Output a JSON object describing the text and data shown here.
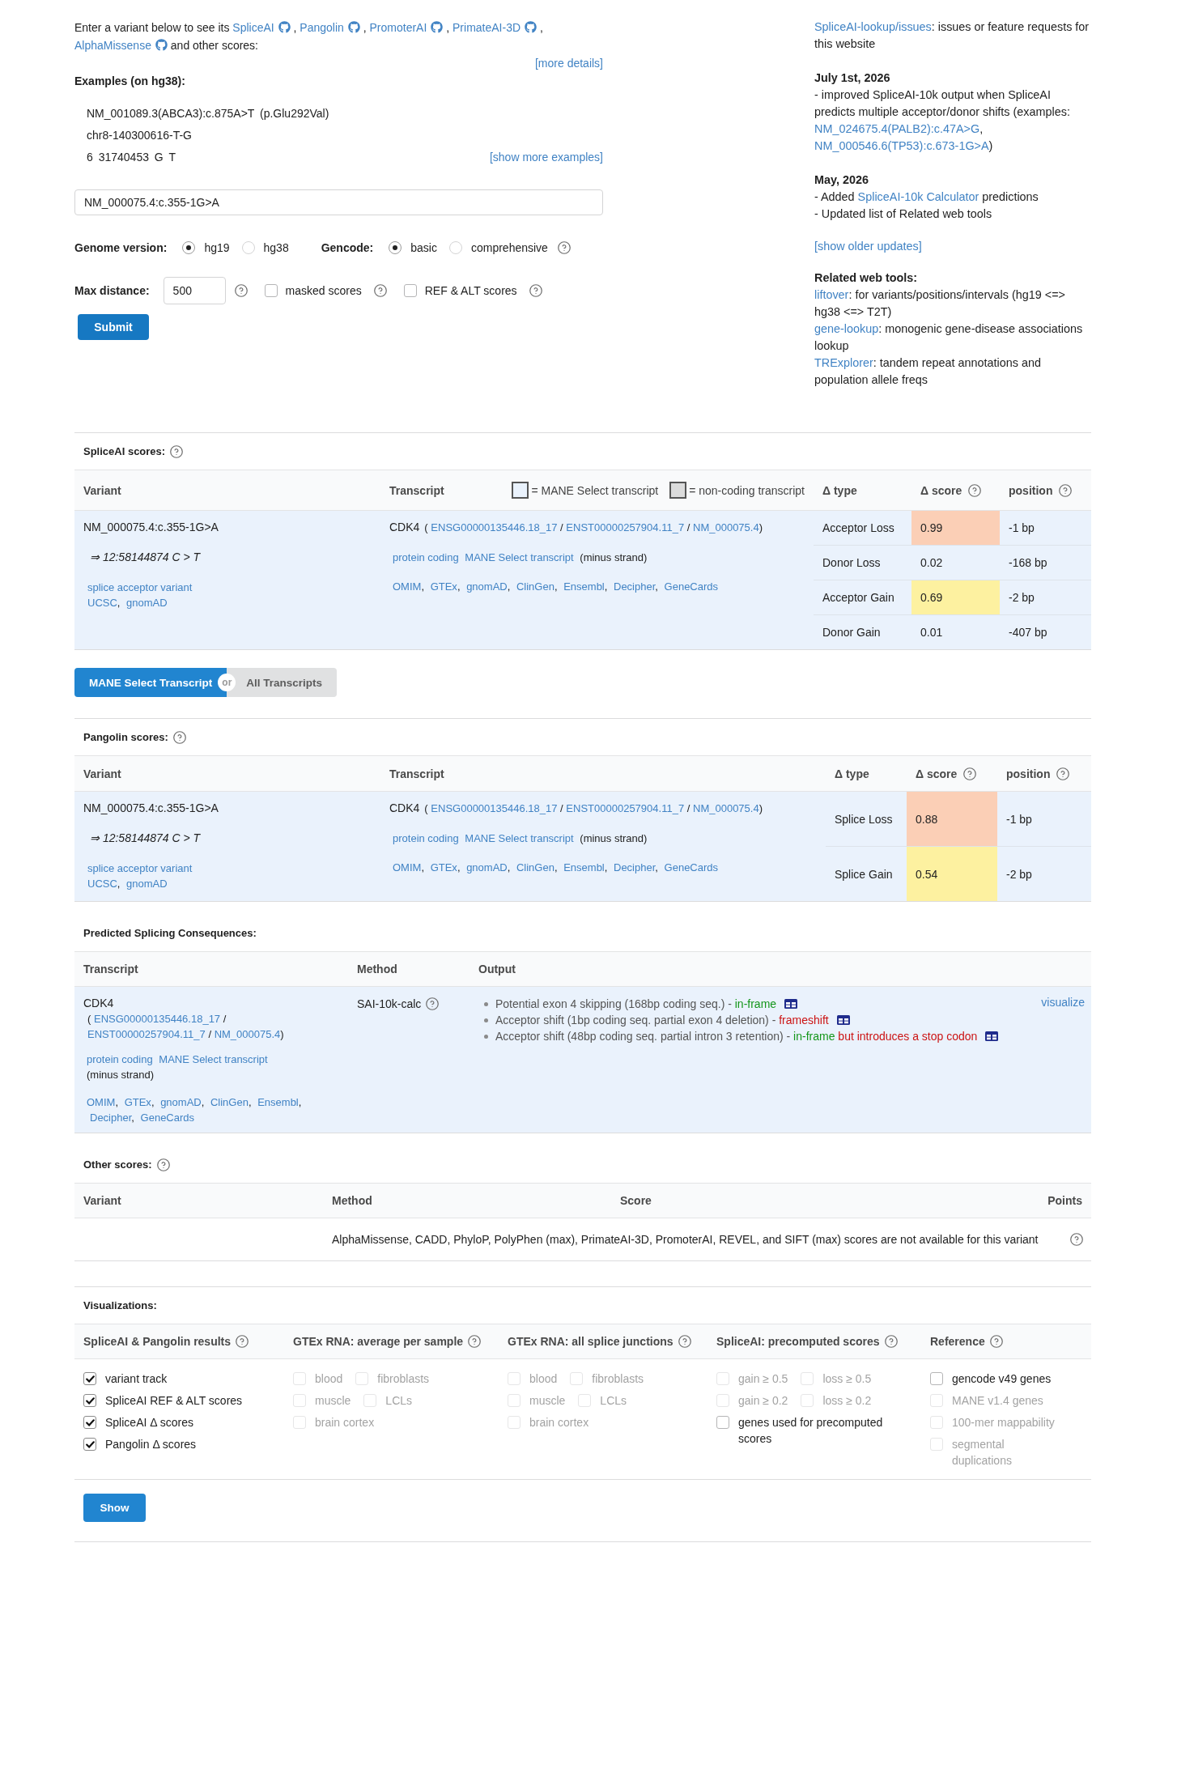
{
  "intro": {
    "lead": "Enter a variant below to see its",
    "tools": [
      {
        "label": "SpliceAI",
        "after": ","
      },
      {
        "label": "Pangolin",
        "after": ","
      },
      {
        "label": "PromoterAI",
        "after": ","
      },
      {
        "label": "PrimateAI-3D",
        "after": ","
      },
      {
        "label": "AlphaMissense"
      }
    ],
    "tail": "and other scores:",
    "more_details": "[more details]"
  },
  "examples": {
    "title": "Examples (on hg38):",
    "items": [
      "NM_001089.3(ABCA3):c.875A>T (p.Glu292Val)",
      "chr8-140300616-T-G",
      "6 31740453 G T"
    ],
    "more": "[show more examples]"
  },
  "variant_input": {
    "value": "NM_000075.4:c.355-1G>A"
  },
  "genome_version": {
    "label": "Genome version:",
    "options": [
      {
        "label": "hg19",
        "selected": true
      },
      {
        "label": "hg38",
        "selected": false
      }
    ]
  },
  "gencode": {
    "label": "Gencode:",
    "options": [
      {
        "label": "basic",
        "selected": true
      },
      {
        "label": "comprehensive",
        "selected": false
      }
    ]
  },
  "max_distance": {
    "label": "Max distance:",
    "value": "500"
  },
  "score_options": [
    {
      "label": "masked scores",
      "checked": false
    },
    {
      "label": "REF & ALT scores",
      "checked": false
    }
  ],
  "submit": "Submit",
  "sidebar": {
    "issues": {
      "link": "SpliceAI-lookup/issues",
      "text": ": issues or feature requests for this website"
    },
    "updates": [
      {
        "date": "July 1st, 2026",
        "lines": [
          {
            "parts": [
              {
                "kind": "text",
                "text": "- improved SpliceAI-10k output when SpliceAI predicts multiple acceptor/donor shifts (examples: "
              },
              {
                "kind": "link",
                "text": "NM_024675.4(PALB2):c.47A>G"
              },
              {
                "kind": "text",
                "text": ", "
              },
              {
                "kind": "link",
                "text": "NM_000546.6(TP53):c.673-1G>A"
              },
              {
                "kind": "text",
                "text": ")"
              }
            ]
          }
        ]
      },
      {
        "date": "May, 2026",
        "lines": [
          {
            "parts": [
              {
                "kind": "text",
                "text": "- Added "
              },
              {
                "kind": "link",
                "text": "SpliceAI-10k Calculator"
              },
              {
                "kind": "text",
                "text": " predictions"
              }
            ]
          },
          {
            "parts": [
              {
                "kind": "text",
                "text": "- Updated list of Related web tools"
              }
            ]
          }
        ]
      }
    ],
    "older": "[show older updates]",
    "related": {
      "title": "Related web tools:",
      "items": [
        {
          "link": "liftover",
          "text": ": for variants/positions/intervals (hg19 <=> hg38 <=> T2T)"
        },
        {
          "link": "gene-lookup",
          "text": ": monogenic gene-disease associations lookup"
        },
        {
          "link": "TRExplorer",
          "text": ": tandem repeat annotations and population allele freqs"
        }
      ]
    }
  },
  "spliceai": {
    "title": "SpliceAI scores:",
    "help": true,
    "columns": [
      {
        "label": "Variant"
      },
      {
        "label": "Transcript"
      },
      {
        "label": "Δ type"
      },
      {
        "label": "Δ score",
        "help": true
      },
      {
        "label": "position",
        "help": true
      }
    ],
    "legend": [
      {
        "label": "= MANE Select transcript",
        "color": "#eaf2fc"
      },
      {
        "label": "= non-coding transcript",
        "color": "#dcdcdc"
      }
    ],
    "variant": {
      "name": "NM_000075.4:c.355-1G>A",
      "position": "⇒ 12:58144874 C > T",
      "consequence": "splice acceptor variant",
      "links": [
        "UCSC",
        "gnomAD"
      ],
      "link_separator": ","
    },
    "transcript": {
      "gene": "CDK4",
      "open": "(",
      "ids": [
        "ENSG00000135446.18_17",
        "ENST00000257904.11_7",
        "NM_000075.4"
      ],
      "id_separator": "/",
      "close": ")",
      "tags": [
        "protein coding",
        "MANE Select transcript"
      ],
      "strand": "(minus strand)",
      "links": [
        "OMIM",
        "GTEx",
        "gnomAD",
        "ClinGen",
        "Ensembl",
        "Decipher",
        "GeneCards"
      ],
      "link_separator": ",",
      "mane_select": true
    },
    "scores": [
      {
        "type": "Acceptor Loss",
        "score": "0.99",
        "position": "-1 bp",
        "color": "#fbcfb6"
      },
      {
        "type": "Donor Loss",
        "score": "0.02",
        "position": "-168 bp"
      },
      {
        "type": "Acceptor Gain",
        "score": "0.69",
        "position": "-2 bp",
        "color": "#fdf1a0"
      },
      {
        "type": "Donor Gain",
        "score": "0.01",
        "position": "-407 bp"
      }
    ]
  },
  "transcript_toggle": {
    "options": [
      {
        "label": "MANE Select Transcript",
        "selected": true
      },
      {
        "label": "All Transcripts",
        "selected": false
      }
    ],
    "separator": "or"
  },
  "pangolin": {
    "title": "Pangolin scores:",
    "help": true,
    "columns": [
      {
        "label": "Variant"
      },
      {
        "label": "Transcript"
      },
      {
        "label": "Δ type"
      },
      {
        "label": "Δ score",
        "help": true
      },
      {
        "label": "position",
        "help": true
      }
    ],
    "variant": {
      "name": "NM_000075.4:c.355-1G>A",
      "position": "⇒ 12:58144874 C > T",
      "consequence": "splice acceptor variant",
      "links": [
        "UCSC",
        "gnomAD"
      ],
      "link_separator": ","
    },
    "transcript": {
      "gene": "CDK4",
      "open": "(",
      "ids": [
        "ENSG00000135446.18_17",
        "ENST00000257904.11_7",
        "NM_000075.4"
      ],
      "id_separator": "/",
      "close": ")",
      "tags": [
        "protein coding",
        "MANE Select transcript"
      ],
      "strand": "(minus strand)",
      "links": [
        "OMIM",
        "GTEx",
        "gnomAD",
        "ClinGen",
        "Ensembl",
        "Decipher",
        "GeneCards"
      ],
      "link_separator": ",",
      "mane_select": true
    },
    "scores": [
      {
        "type": "Splice Loss",
        "score": "0.88",
        "position": "-1 bp",
        "color": "#fbcfb6"
      },
      {
        "type": "Splice Gain",
        "score": "0.54",
        "position": "-2 bp",
        "color": "#fdf1a0"
      }
    ]
  },
  "consequences": {
    "title": "Predicted Splicing Consequences:",
    "columns": [
      {
        "label": "Transcript"
      },
      {
        "label": "Method"
      },
      {
        "label": "Output"
      }
    ],
    "transcript": {
      "gene": "CDK4",
      "open": "(",
      "ids": [
        "ENSG00000135446.18_17",
        "ENST00000257904.11_7",
        "NM_000075.4"
      ],
      "id_separator": "/",
      "close": ")",
      "tags": [
        "protein coding",
        "MANE Select transcript"
      ],
      "strand": "(minus strand)",
      "links": [
        "OMIM",
        "GTEx",
        "gnomAD",
        "ClinGen",
        "Ensembl",
        "Decipher",
        "GeneCards"
      ],
      "link_separator": ",",
      "mane_select": true
    },
    "method": "SAI-10k-calc",
    "outputs": [
      {
        "parts": [
          {
            "kind": "text",
            "text": "Potential exon 4 skipping (168bp coding seq.) - "
          },
          {
            "kind": "ok",
            "text": "in-frame"
          }
        ]
      },
      {
        "parts": [
          {
            "kind": "text",
            "text": "Acceptor shift (1bp coding seq. partial exon 4 deletion) - "
          },
          {
            "kind": "bad",
            "text": "frameshift"
          }
        ]
      },
      {
        "parts": [
          {
            "kind": "text",
            "text": "Acceptor shift (48bp coding seq. partial intron 3 retention) - "
          },
          {
            "kind": "ok",
            "text": "in-frame"
          },
          {
            "kind": "bad",
            "text": " but introduces a stop codon"
          }
        ]
      }
    ],
    "visualize": "visualize"
  },
  "other_scores": {
    "title": "Other scores:",
    "help": true,
    "columns": [
      {
        "label": "Variant"
      },
      {
        "label": "Method"
      },
      {
        "label": "Score"
      },
      {
        "label": "Points"
      }
    ],
    "message": "AlphaMissense, CADD, PhyloP, PolyPhen (max), PrimateAI-3D, PromoterAI, REVEL, and SIFT (max) scores are not available for this variant"
  },
  "visualizations": {
    "title": "Visualizations:",
    "groups": [
      {
        "title": "SpliceAI & Pangolin results",
        "help": true,
        "rows": [
          {
            "options": [
              {
                "label": "variant track",
                "checked": true,
                "disabled": false
              }
            ]
          },
          {
            "options": [
              {
                "label": "SpliceAI REF & ALT scores",
                "checked": true,
                "disabled": false
              }
            ]
          },
          {
            "options": [
              {
                "label": "SpliceAI Δ scores",
                "checked": true,
                "disabled": false
              }
            ]
          },
          {
            "options": [
              {
                "label": "Pangolin Δ scores",
                "checked": true,
                "disabled": false
              }
            ]
          }
        ]
      },
      {
        "title": "GTEx RNA: average per sample",
        "help": true,
        "rows": [
          {
            "options": [
              {
                "label": "blood",
                "checked": false,
                "disabled": true
              },
              {
                "label": "fibroblasts",
                "checked": false,
                "disabled": true
              }
            ]
          },
          {
            "options": [
              {
                "label": "muscle",
                "checked": false,
                "disabled": true
              },
              {
                "label": "LCLs",
                "checked": false,
                "disabled": true
              }
            ]
          },
          {
            "options": [
              {
                "label": "brain cortex",
                "checked": false,
                "disabled": true
              }
            ]
          }
        ]
      },
      {
        "title": "GTEx RNA: all splice junctions",
        "help": true,
        "rows": [
          {
            "options": [
              {
                "label": "blood",
                "checked": false,
                "disabled": true
              },
              {
                "label": "fibroblasts",
                "checked": false,
                "disabled": true
              }
            ]
          },
          {
            "options": [
              {
                "label": "muscle",
                "checked": false,
                "disabled": true
              },
              {
                "label": "LCLs",
                "checked": false,
                "disabled": true
              }
            ]
          },
          {
            "options": [
              {
                "label": "brain cortex",
                "checked": false,
                "disabled": true
              }
            ]
          }
        ]
      },
      {
        "title": "SpliceAI: precomputed scores",
        "help": true,
        "rows": [
          {
            "options": [
              {
                "label": "gain ≥ 0.5",
                "checked": false,
                "disabled": true
              },
              {
                "label": "loss ≥ 0.5",
                "checked": false,
                "disabled": true
              }
            ]
          },
          {
            "options": [
              {
                "label": "gain ≥ 0.2",
                "checked": false,
                "disabled": true
              },
              {
                "label": "loss ≥ 0.2",
                "checked": false,
                "disabled": true
              }
            ]
          },
          {
            "options": [
              {
                "label": "genes used for precomputed scores",
                "checked": false,
                "disabled": false
              }
            ]
          }
        ]
      },
      {
        "title": "Reference",
        "help": true,
        "rows": [
          {
            "options": [
              {
                "label": "gencode v49 genes",
                "checked": false,
                "disabled": false
              }
            ]
          },
          {
            "options": [
              {
                "label": "MANE v1.4 genes",
                "checked": false,
                "disabled": true
              }
            ]
          },
          {
            "options": [
              {
                "label": "100-mer mappability",
                "checked": false,
                "disabled": true
              }
            ]
          },
          {
            "options": [
              {
                "label": "segmental duplications",
                "checked": false,
                "disabled": true
              }
            ]
          }
        ]
      }
    ],
    "show": "Show"
  }
}
